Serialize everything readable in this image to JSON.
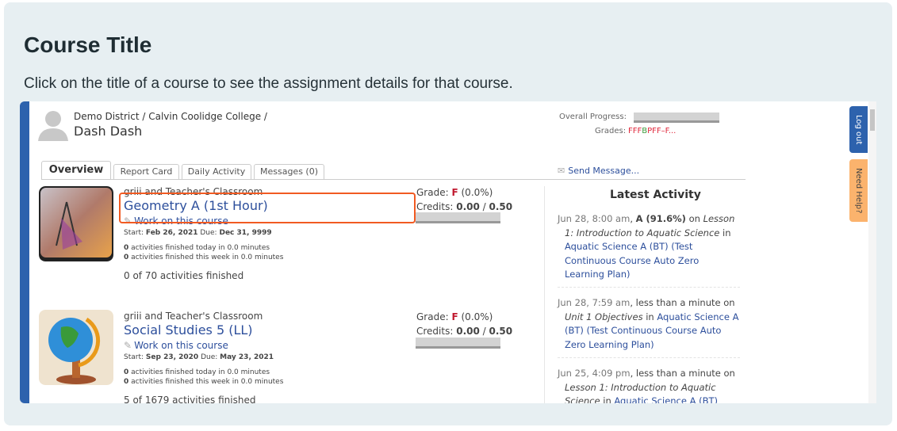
{
  "heading": {
    "title": "Course Title",
    "description": "Click on the title of a course to see the assignment details for that course."
  },
  "header": {
    "breadcrumb": "Demo District / Calvin Coolidge College /",
    "student": "Dash Dash",
    "overall_progress_label": "Overall Progress:",
    "overall_progress": 0,
    "grades_label": "Grades:",
    "grades": [
      "FFF",
      "B",
      "PFF–F..."
    ]
  },
  "tabs": [
    {
      "label": "Overview",
      "active": true
    },
    {
      "label": "Report Card"
    },
    {
      "label": "Daily Activity"
    },
    {
      "label": "Messages (0)"
    }
  ],
  "send_message": "Send Message...",
  "courses": [
    {
      "classroom": "griii and Teacher's Classroom",
      "title": "Geometry A (1st Hour)",
      "work": "Work on this course",
      "start_label": "Start:",
      "start": "Feb 26, 2021",
      "due_label": "Due:",
      "due": "Dec 31, 9999",
      "today_n": "0",
      "today": " activities finished today in 0.0 minutes",
      "week_n": "0",
      "week": " activities finished this week in 0.0 minutes",
      "finished": "0 of 70 activities finished",
      "grade_label": "Grade:",
      "grade": "F",
      "grade_pct": "(0.0%)",
      "credits_label": "Credits:",
      "credits": "0.00",
      "credits_total": "0.50",
      "progress": 0
    },
    {
      "classroom": "griii and Teacher's Classroom",
      "title": "Social Studies 5 (LL)",
      "work": "Work on this course",
      "start_label": "Start:",
      "start": "Sep 23, 2020",
      "due_label": "Due:",
      "due": "May 23, 2021",
      "today_n": "0",
      "today": " activities finished today in 0.0 minutes",
      "week_n": "0",
      "week": " activities finished this week in 0.0 minutes",
      "finished": "5 of 1679 activities finished",
      "grade_label": "Grade:",
      "grade": "F",
      "grade_pct": "(0.0%)",
      "credits_label": "Credits:",
      "credits": "0.00",
      "credits_total": "0.50",
      "progress": 0
    }
  ],
  "latest": {
    "title": "Latest Activity",
    "entries": [
      {
        "time": "Jun 28, 8:00 am",
        "b": "A (91.6%)",
        "mid": " on ",
        "item": "Lesson 1: Introduction to Aquatic Science",
        "in": " in ",
        "course": "Aquatic Science A (BT) (Test Continuous Course Auto Zero Learning Plan)"
      },
      {
        "time": "Jun 28, 7:59 am",
        "b": "",
        "mid": " less than a minute on ",
        "item": "Unit 1 Objectives",
        "in": " in ",
        "course": "Aquatic Science A (BT) (Test Continuous Course Auto Zero Learning Plan)"
      },
      {
        "time": "Jun 25, 4:09 pm",
        "b": "",
        "mid": " less than a minute on ",
        "item": "Lesson 1: Introduction to Aquatic Science",
        "in": " in ",
        "course": "Aquatic Science A (BT) (Test"
      }
    ]
  },
  "side": {
    "logout": "Log out",
    "help": "Need Help?"
  },
  "colors": {
    "accent": "#2d62ad",
    "highlight": "#f15a22",
    "link": "#2d4f9c",
    "fail": "#c0182e"
  }
}
